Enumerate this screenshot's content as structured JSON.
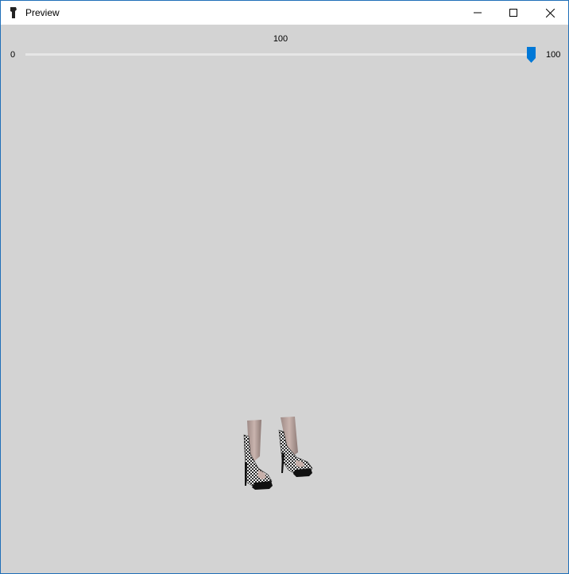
{
  "window": {
    "title": "Preview",
    "controls": {
      "minimize": "minimize-icon",
      "maximize": "maximize-icon",
      "close": "close-icon"
    }
  },
  "slider": {
    "min_label": "0",
    "max_label": "100",
    "current_label": "100",
    "min": 0,
    "max": 100,
    "value": 100,
    "accent_color": "#0078d7"
  },
  "preview": {
    "content": "high-heel shoes model",
    "background_color": "#d3d3d3"
  }
}
